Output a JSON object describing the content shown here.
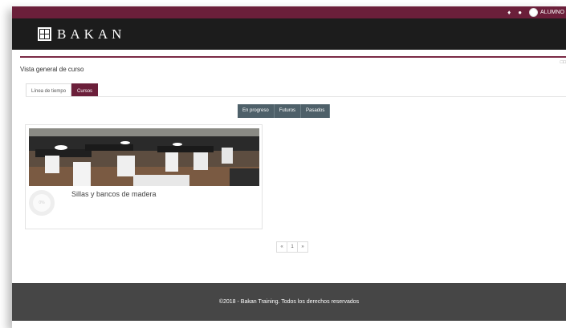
{
  "topbar": {
    "user_label": "ALUMNO",
    "icons": [
      "bell-icon",
      "chat-icon"
    ],
    "color": "#6b1f3a"
  },
  "brand": {
    "name": "BAKAN"
  },
  "overview": {
    "title": "Vista general de curso",
    "tabs": [
      {
        "label": "Línea de tiempo",
        "active": false
      },
      {
        "label": "Cursos",
        "active": true
      }
    ],
    "filters": [
      "En progreso",
      "Futuros",
      "Pasados"
    ]
  },
  "course": {
    "name": "Sillas y bancos de madera",
    "progress_label": "0%",
    "progress": 0
  },
  "pagination": {
    "prev": "«",
    "page": "1",
    "next": "»"
  },
  "footer": {
    "text": "©2018 - Bakan Training. Todos los derechos reservados"
  },
  "colors": {
    "accent": "#6b1f3a",
    "header_dark": "#1c1c1c",
    "filter_btn": "#4e6069",
    "footer": "#464646"
  }
}
